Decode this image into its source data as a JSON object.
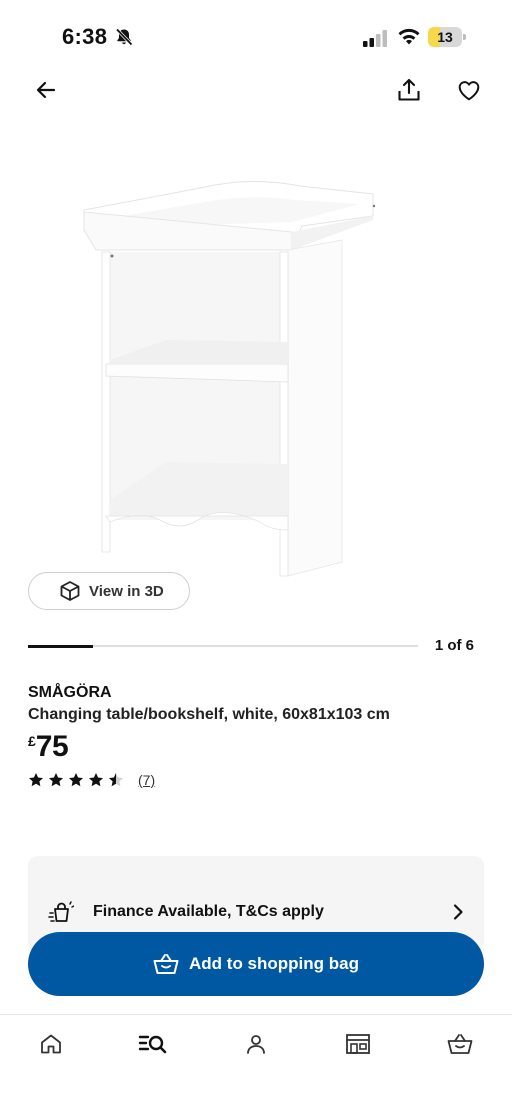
{
  "status_bar": {
    "time": "6:38",
    "battery_level": "13",
    "battery_color": "#f6d84a"
  },
  "header": {
    "back_icon": "arrow-left-icon",
    "share_icon": "share-icon",
    "favourite_icon": "heart-icon"
  },
  "gallery": {
    "view_3d_label": "View in 3D",
    "view_3d_icon": "cube-icon",
    "current_image": 1,
    "total_images": 6,
    "pager_text": "1 of 6"
  },
  "product": {
    "name": "SMÅGÖRA",
    "description": "Changing table/bookshelf, white, 60x81x103 cm",
    "currency_symbol": "£",
    "price": "75",
    "rating": 4.5,
    "rating_max": 5,
    "review_count": "(7)"
  },
  "finance": {
    "icon": "shopping-bag-sparkle-icon",
    "text": "Finance Available, T&Cs apply",
    "chevron_icon": "chevron-right-icon"
  },
  "cta": {
    "label": "Add to shopping bag",
    "icon": "basket-icon",
    "color": "#0058a3"
  },
  "tab_bar": {
    "items": [
      {
        "icon": "home-icon",
        "active": false
      },
      {
        "icon": "search-list-icon",
        "active": true
      },
      {
        "icon": "profile-icon",
        "active": false
      },
      {
        "icon": "store-icon",
        "active": false
      },
      {
        "icon": "basket-icon",
        "active": false
      }
    ]
  }
}
